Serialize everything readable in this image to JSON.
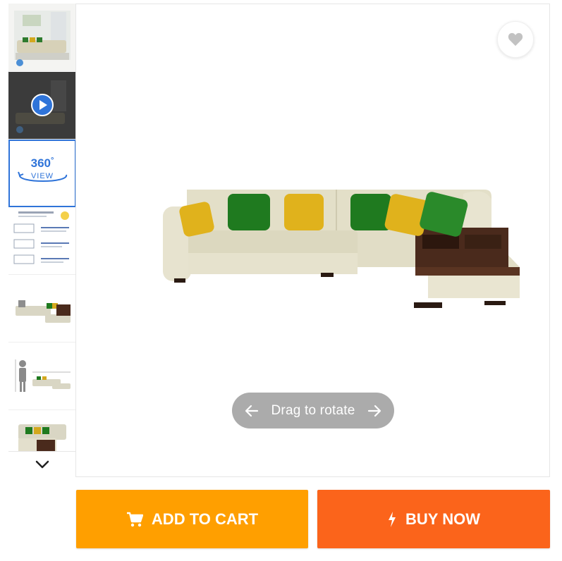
{
  "gallery": {
    "thumbnails": [
      {
        "name": "thumb-room-sofa",
        "kind": "image"
      },
      {
        "name": "thumb-video",
        "kind": "video"
      },
      {
        "name": "thumb-360-view",
        "kind": "360",
        "label_top": "360",
        "label_bottom": "VIEW"
      },
      {
        "name": "thumb-dimensions-sheet",
        "kind": "image"
      },
      {
        "name": "thumb-side-view",
        "kind": "image"
      },
      {
        "name": "thumb-scale-person",
        "kind": "image"
      },
      {
        "name": "thumb-angle-view",
        "kind": "image"
      }
    ]
  },
  "viewer": {
    "rotate_hint": "Drag to rotate"
  },
  "actions": {
    "add_to_cart": "ADD TO CART",
    "buy_now": "BUY NOW"
  },
  "colors": {
    "add_to_cart": "#ff9f00",
    "buy_now": "#fb641b",
    "accent_blue": "#2f74d9",
    "sofa_fabric": "#e6e2cf",
    "cushion_green": "#1f7a1f",
    "cushion_yellow": "#e0b21c",
    "wood": "#4a2a1c"
  }
}
